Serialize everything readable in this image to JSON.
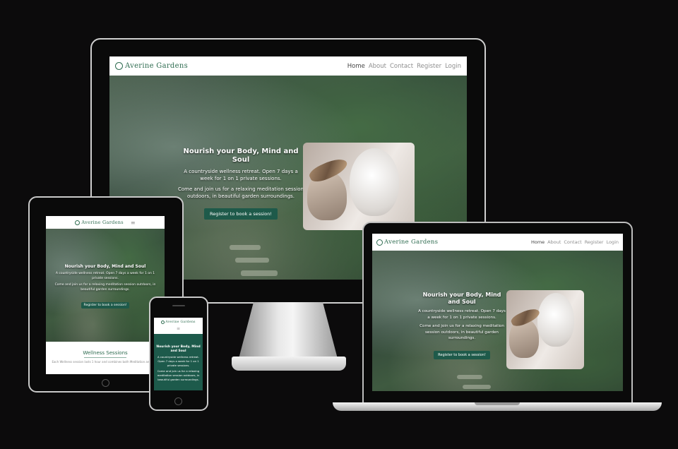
{
  "site": {
    "logo_text": "Averine Gardens",
    "nav": [
      "Home",
      "About",
      "Contact",
      "Register",
      "Login"
    ],
    "hero_title": "Nourish your Body, Mind and Soul",
    "hero_line1": "A countryside wellness retreat. Open 7 days a week for 1 on 1 private sessions.",
    "hero_line2": "Come and join us for a relaxing meditation session outdoors, in beautiful garden surroundings.",
    "cta": "Register to book a session!",
    "section_title": "Wellness Sessions",
    "section_text": "Each Wellness session lasts 1 hour and combines both Meditation and Yoga",
    "burger": "≡"
  },
  "colors": {
    "brand_green": "#2d6b4f",
    "cta_green": "#1e5a4a",
    "background": "#0c0b0c"
  }
}
